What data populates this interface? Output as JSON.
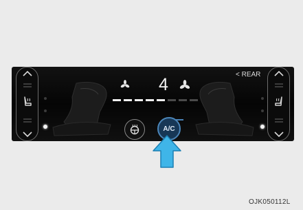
{
  "panel": {
    "fan_speed": "4",
    "rear_label": "< REAR",
    "ac_label": "A/C",
    "fan_level_fraction": 0.5
  },
  "icons": {
    "left_up": "chevron-up-icon",
    "left_down": "chevron-down-icon",
    "right_up": "chevron-up-icon",
    "right_down": "chevron-down-icon",
    "fan_low": "fan-icon",
    "fan_high": "fan-icon",
    "heated_steering": "steering-wheel-heat-icon",
    "driver_seat": "seat-heat-icon",
    "passenger_seat": "seat-heat-icon",
    "pointer": "arrow-up-icon"
  },
  "colors": {
    "ac_active": "#4b85b8",
    "pointer": "#3fb5e8"
  },
  "caption": "OJK050112L"
}
